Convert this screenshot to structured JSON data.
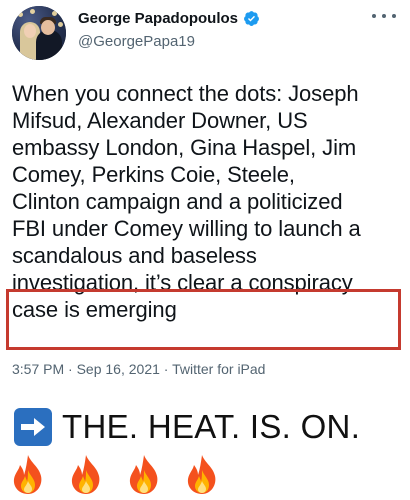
{
  "tweet": {
    "display_name": "George Papadopoulos",
    "handle": "@GeorgePapa19",
    "verified": true,
    "text_lines": [
      "When you connect the dots: Joseph",
      "Mifsud, Alexander Downer, US",
      "embassy London, Gina Haspel, Jim",
      "Comey, Perkins Coie, Steele,",
      "Clinton campaign and a politicized",
      "FBI under Comey willing to launch a",
      "scandalous and baseless",
      "investigation, it’s clear a conspiracy",
      "case is emerging"
    ],
    "time": "3:57 PM",
    "separator": " · ",
    "date": "Sep 16, 2021",
    "source": "Twitter for iPad"
  },
  "caption": {
    "text": "THE. HEAT. IS. ON.",
    "arrow_icon": "right-arrow-icon",
    "fire_count": 4
  },
  "colors": {
    "verified_blue": "#1d9bf0",
    "highlight_red": "#c53a2f",
    "secondary_text": "#536471",
    "arrow_blue": "#2b6fbf"
  }
}
